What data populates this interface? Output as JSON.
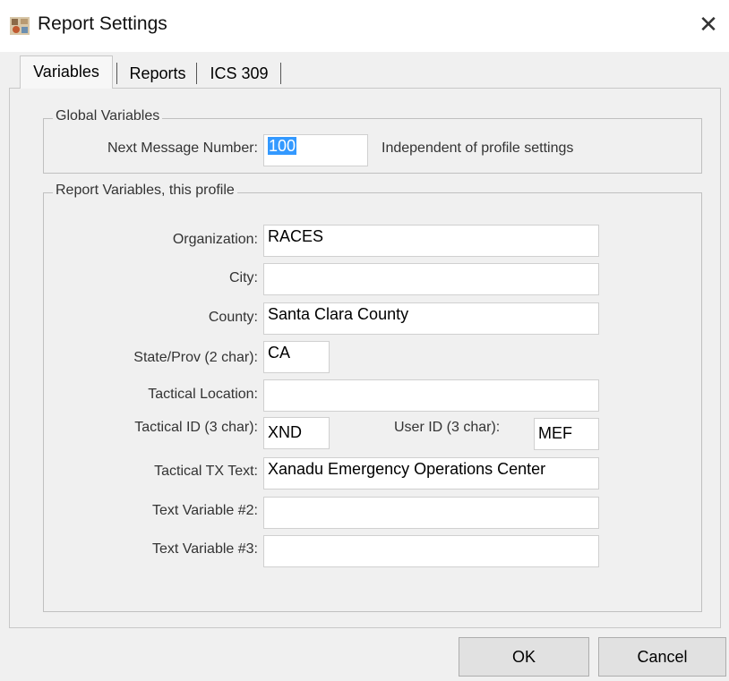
{
  "window": {
    "title": "Report Settings",
    "close_glyph": "✕",
    "icon": "app-icon"
  },
  "tabs": [
    {
      "label": "Variables",
      "active": true
    },
    {
      "label": "Reports",
      "active": false
    },
    {
      "label": "ICS 309",
      "active": false
    }
  ],
  "global_group": {
    "title": "Global Variables",
    "next_message_label": "Next Message Number:",
    "next_message_value": "100",
    "note": "Independent of profile settings"
  },
  "report_group": {
    "title": "Report Variables, this profile",
    "organization_label": "Organization:",
    "organization_value": "RACES",
    "city_label": "City:",
    "city_value": "",
    "county_label": "County:",
    "county_value": "Santa Clara County",
    "state_label": "State/Prov (2 char):",
    "state_value": "CA",
    "tactical_location_label": "Tactical Location:",
    "tactical_location_value": "",
    "tactical_id_label": "Tactical ID (3 char):",
    "tactical_id_value": "XND",
    "user_id_label": "User ID (3 char):",
    "user_id_value": "MEF",
    "tactical_tx_label": "Tactical TX Text:",
    "tactical_tx_value": "Xanadu Emergency Operations Center",
    "text_var2_label": "Text Variable #2:",
    "text_var2_value": "",
    "text_var3_label": "Text Variable #3:",
    "text_var3_value": ""
  },
  "buttons": {
    "ok": "OK",
    "cancel": "Cancel"
  }
}
